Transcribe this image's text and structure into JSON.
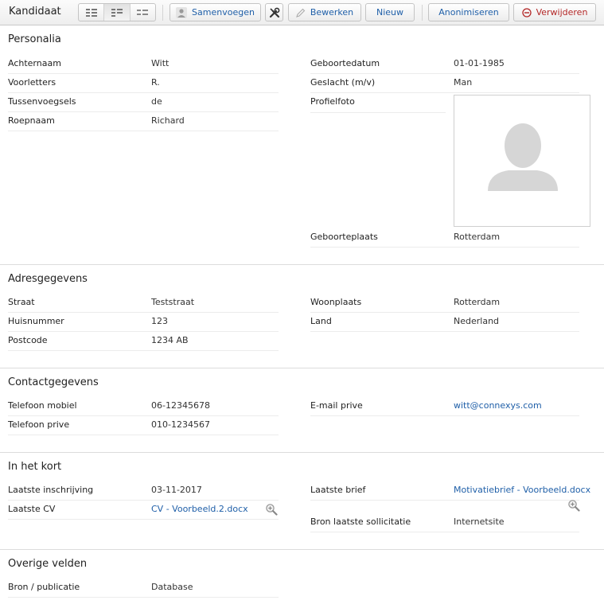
{
  "toolbar": {
    "title": "Kandidaat",
    "merge_label": "Samenvoegen",
    "edit_label": "Bewerken",
    "new_label": "Nieuw",
    "anonymize_label": "Anonimiseren",
    "delete_label": "Verwijderen"
  },
  "personalia": {
    "title": "Personalia",
    "achternaam": {
      "label": "Achternaam",
      "value": "Witt"
    },
    "voorletters": {
      "label": "Voorletters",
      "value": "R."
    },
    "tussenvoegsels": {
      "label": "Tussenvoegsels",
      "value": "de"
    },
    "roepnaam": {
      "label": "Roepnaam",
      "value": "Richard"
    },
    "geboortedatum": {
      "label": "Geboortedatum",
      "value": "01-01-1985"
    },
    "geslacht": {
      "label": "Geslacht (m/v)",
      "value": "Man"
    },
    "profielfoto": {
      "label": "Profielfoto"
    },
    "geboorteplaats": {
      "label": "Geboorteplaats",
      "value": "Rotterdam"
    }
  },
  "adres": {
    "title": "Adresgegevens",
    "straat": {
      "label": "Straat",
      "value": "Teststraat"
    },
    "huisnummer": {
      "label": "Huisnummer",
      "value": "123"
    },
    "postcode": {
      "label": "Postcode",
      "value": "1234 AB"
    },
    "woonplaats": {
      "label": "Woonplaats",
      "value": "Rotterdam"
    },
    "land": {
      "label": "Land",
      "value": "Nederland"
    }
  },
  "contact": {
    "title": "Contactgegevens",
    "mobiel": {
      "label": "Telefoon mobiel",
      "value": "06-12345678"
    },
    "prive": {
      "label": "Telefoon prive",
      "value": "010-1234567"
    },
    "email": {
      "label": "E-mail prive",
      "value": "witt@connexys.com"
    }
  },
  "kort": {
    "title": "In het kort",
    "inschrijving": {
      "label": "Laatste inschrijving",
      "value": "03-11-2017"
    },
    "cv": {
      "label": "Laatste CV",
      "value": "CV - Voorbeeld.2.docx"
    },
    "brief": {
      "label": "Laatste brief",
      "value": "Motivatiebrief - Voorbeeld.docx"
    },
    "bron_sollicitatie": {
      "label": "Bron laatste sollicitatie",
      "value": "Internetsite"
    }
  },
  "overig": {
    "title": "Overige velden",
    "bron": {
      "label": "Bron / publicatie",
      "value": "Database"
    }
  },
  "colors": {
    "link": "#1f5fa8",
    "danger": "#b32727",
    "placeholder": "#d6d6d6"
  }
}
